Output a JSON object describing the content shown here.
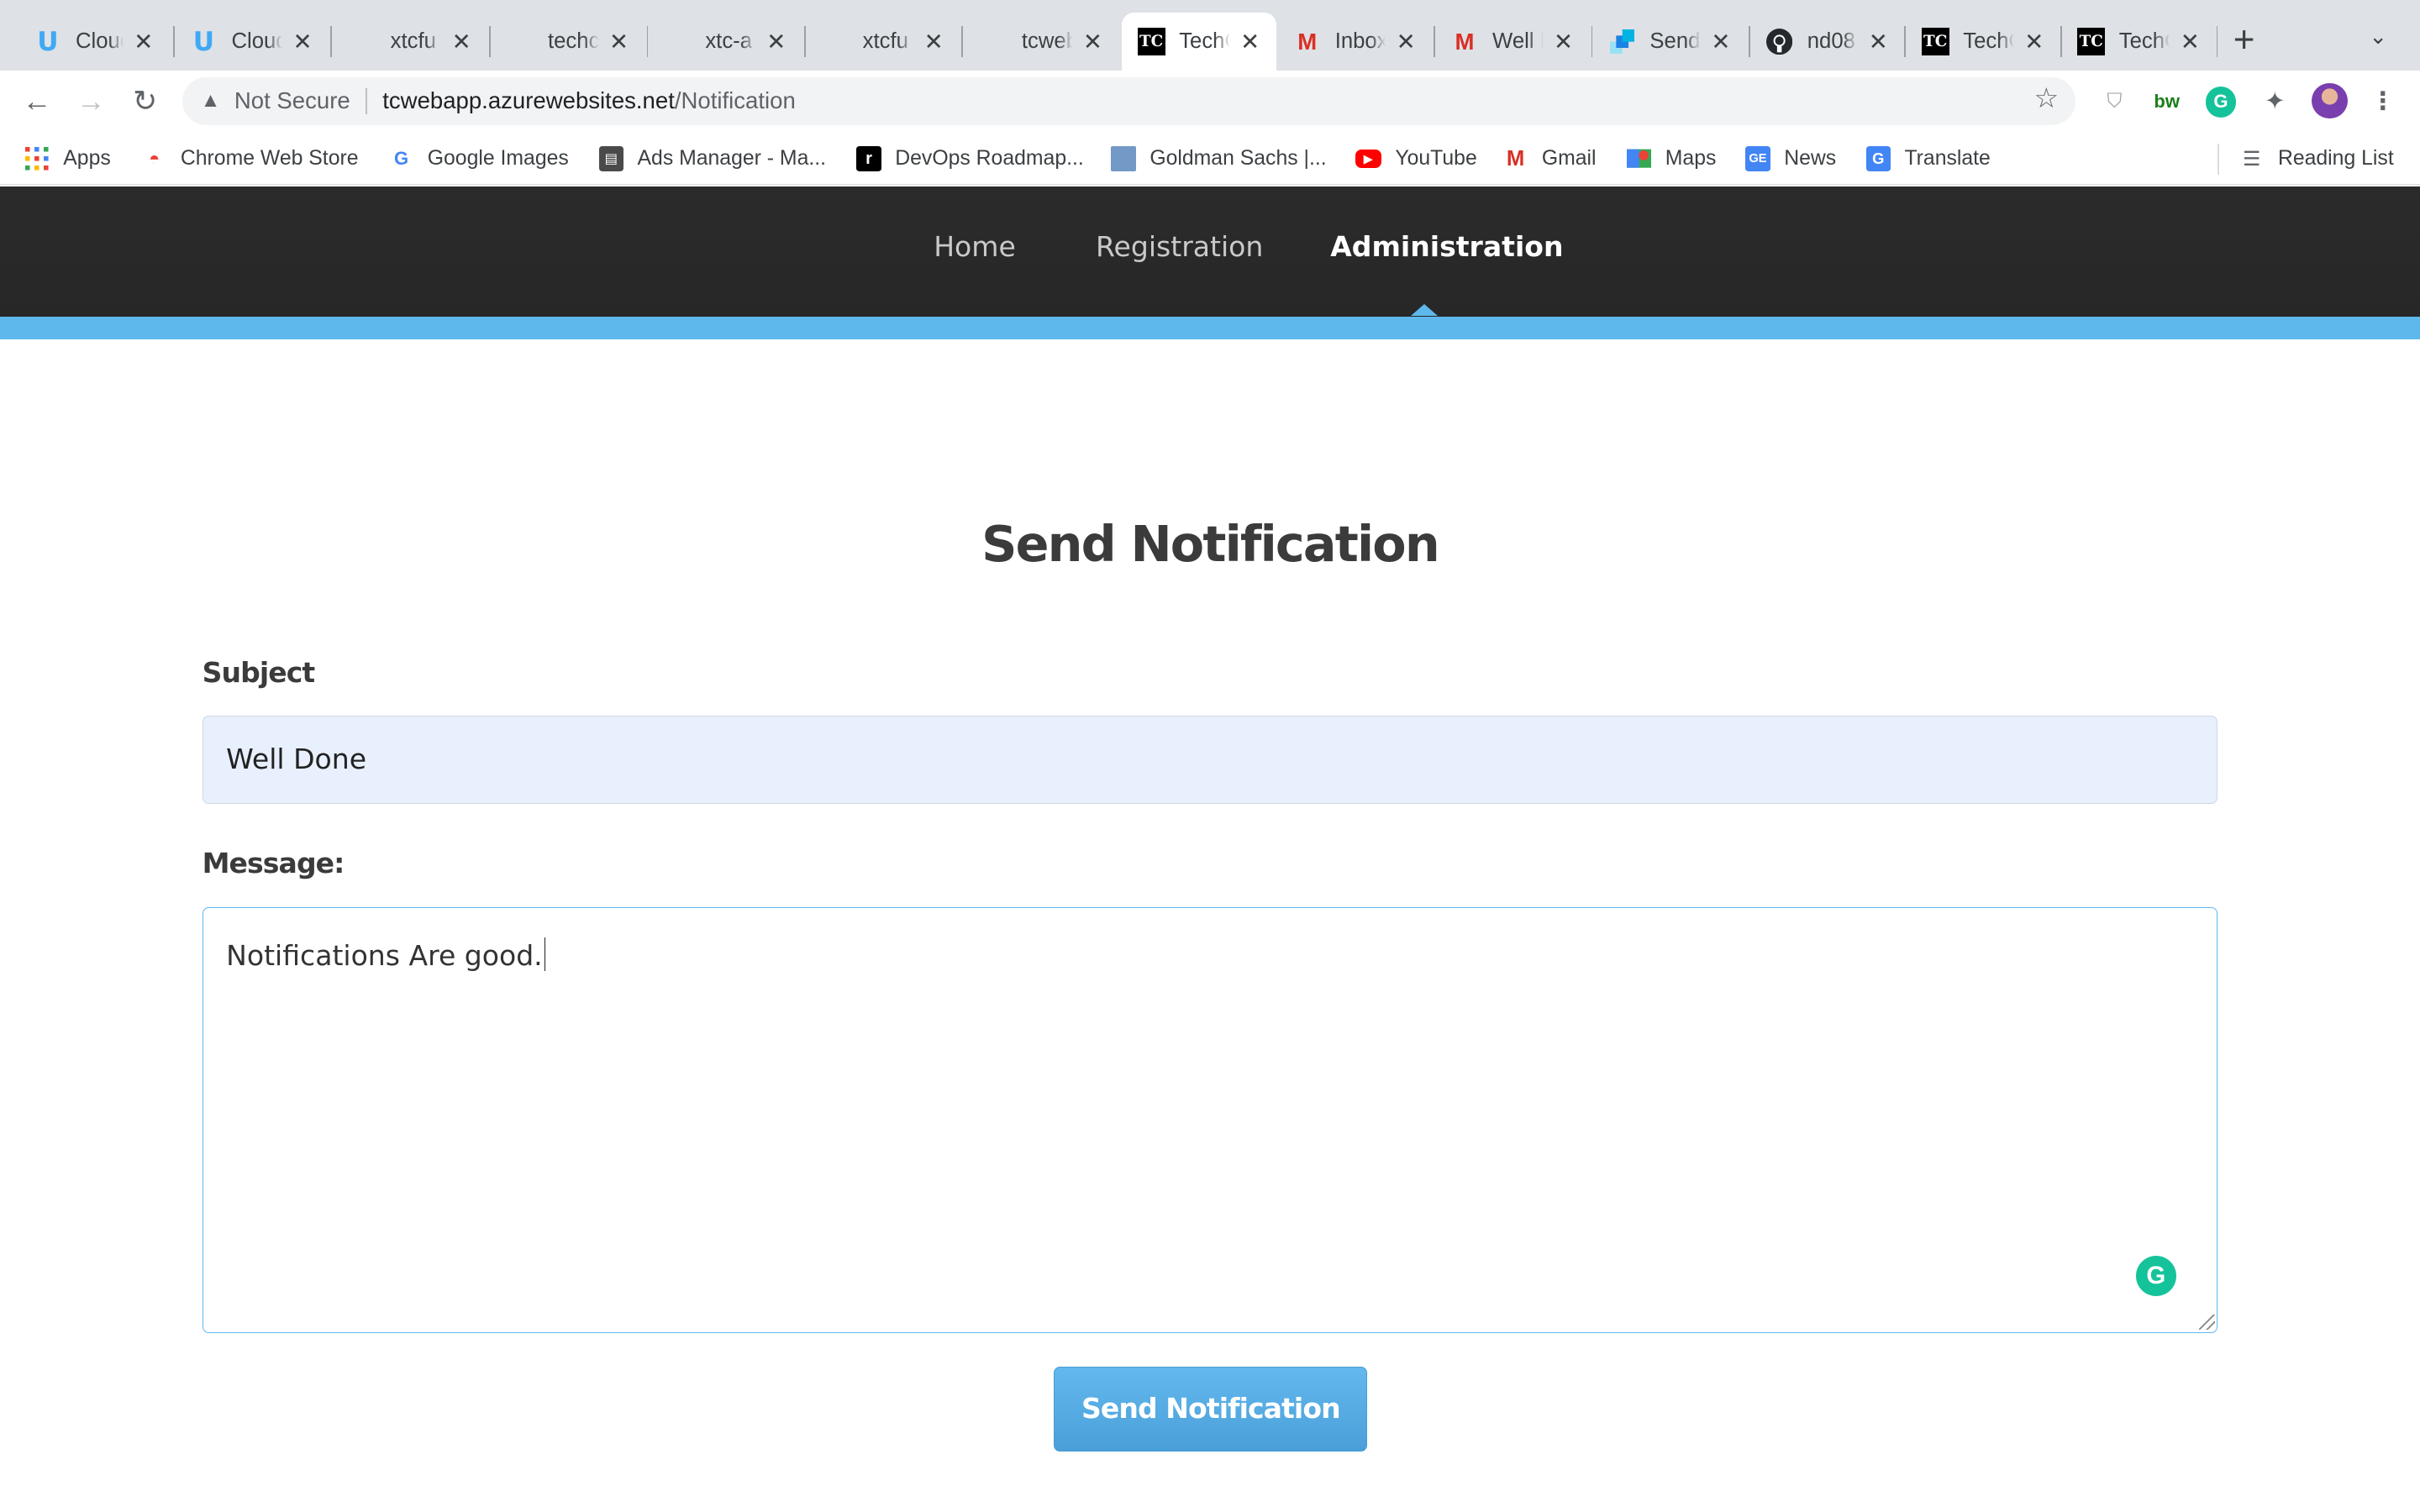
{
  "browser": {
    "tabs": [
      {
        "title": "Cloud",
        "favicon": "udacity-icon"
      },
      {
        "title": "Cloud",
        "favicon": "udacity-icon"
      },
      {
        "title": "xtcfu",
        "favicon": "microsoft-icon"
      },
      {
        "title": "techc",
        "favicon": "microsoft-icon"
      },
      {
        "title": "xtc-a",
        "favicon": "microsoft-icon"
      },
      {
        "title": "xtcfu",
        "favicon": "microsoft-icon"
      },
      {
        "title": "tcweb",
        "favicon": "microsoft-icon"
      },
      {
        "title": "TechC",
        "favicon": "techconf-icon",
        "active": true
      },
      {
        "title": "Inbox",
        "favicon": "gmail-icon"
      },
      {
        "title": "Well D",
        "favicon": "gmail-icon"
      },
      {
        "title": "Send",
        "favicon": "sendgrid-icon"
      },
      {
        "title": "nd08",
        "favicon": "github-icon"
      },
      {
        "title": "TechC",
        "favicon": "techconf-icon"
      },
      {
        "title": "TechC",
        "favicon": "techconf-icon"
      }
    ],
    "new_tab_label": "+",
    "address": {
      "security": "Not Secure",
      "host": "tcwebapp.azurewebsites.net",
      "path": "/Notification"
    },
    "bookmarks": [
      {
        "label": "Apps",
        "icon": "apps-grid-icon"
      },
      {
        "label": "Chrome Web Store",
        "icon": "chrome-web-store-icon"
      },
      {
        "label": "Google Images",
        "icon": "google-icon"
      },
      {
        "label": "Ads Manager - Ma...",
        "icon": "ads-manager-icon"
      },
      {
        "label": "DevOps Roadmap...",
        "icon": "roadmap-icon"
      },
      {
        "label": "Goldman Sachs |...",
        "icon": "goldman-icon"
      },
      {
        "label": "YouTube",
        "icon": "youtube-icon"
      },
      {
        "label": "Gmail",
        "icon": "gmail-icon"
      },
      {
        "label": "Maps",
        "icon": "maps-icon"
      },
      {
        "label": "News",
        "icon": "news-icon"
      },
      {
        "label": "Translate",
        "icon": "translate-icon"
      }
    ],
    "reading_list": "Reading List"
  },
  "site": {
    "nav": {
      "home": "Home",
      "registration": "Registration",
      "administration": "Administration",
      "active": "administration"
    },
    "page_title": "Send Notification",
    "form": {
      "subject_label": "Subject",
      "subject_value": "Well Done",
      "message_label": "Message:",
      "message_value": "Notifications Are good.",
      "submit_label": "Send Notification"
    },
    "colors": {
      "nav_bg": "#2b2b2b",
      "accent": "#5eb8ec",
      "input_autofill_bg": "#e8f0fe"
    }
  }
}
